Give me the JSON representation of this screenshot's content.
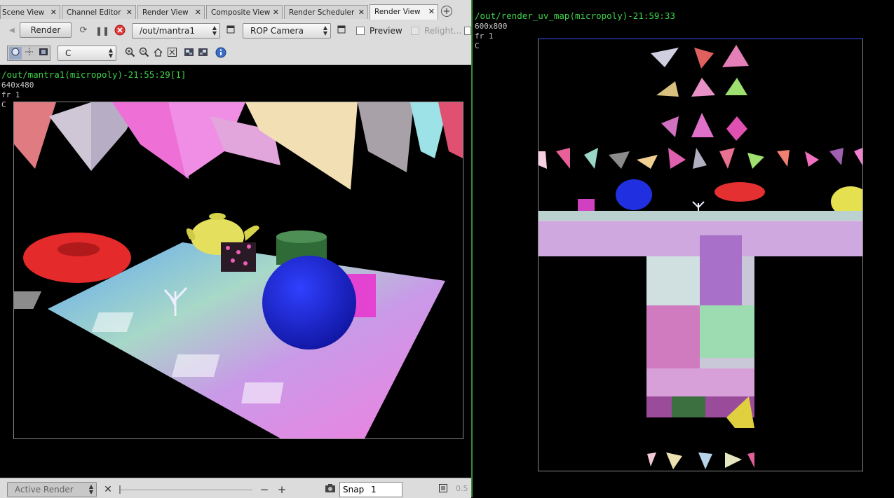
{
  "tabs": [
    {
      "label": "Scene View"
    },
    {
      "label": "Channel Editor"
    },
    {
      "label": "Render View"
    },
    {
      "label": "Composite View"
    },
    {
      "label": "Render Scheduler"
    },
    {
      "label": "Render View",
      "active": true
    }
  ],
  "toolbar": {
    "render_label": "Render",
    "output_driver": "/out/mantra1",
    "camera": "ROP Camera",
    "preview_label": "Preview",
    "relight_label": "Relight..."
  },
  "toolbar2": {
    "channel": "C"
  },
  "left_viewer": {
    "title": "/out/mantra1(micropoly)-21:55:29[1]",
    "resolution": "640x480",
    "frame": "fr 1",
    "channel": "C"
  },
  "right_viewer": {
    "title": "/out/render_uv_map(micropoly)-21:59:33",
    "resolution": "600x800",
    "frame": "fr 1",
    "channel": "C"
  },
  "bottombar": {
    "active_render_label": "Active Render",
    "snap_label": "Snap",
    "snap_value": "1",
    "trailing": "0.5"
  },
  "colors": {
    "green_text": "#3fd34a",
    "panel_bg": "#dcdcdc",
    "viewer_bg": "#000000"
  }
}
